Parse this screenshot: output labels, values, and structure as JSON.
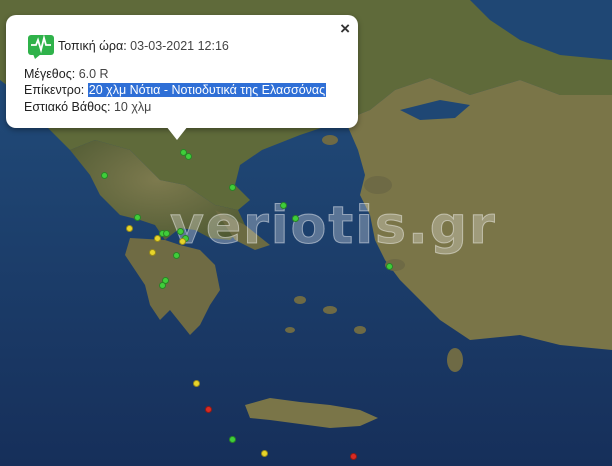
{
  "popup": {
    "time_label": "Τοπική ώρα:",
    "time_value": "03-03-2021 12:16",
    "magnitude_label": "Μέγεθος:",
    "magnitude_value": "6.0 R",
    "epicenter_label": "Επίκεντρο:",
    "epicenter_value": "20 χλμ Νότια - Νοτιοδυτικά της Ελασσόνας",
    "depth_label": "Εστιακό Βάθος:",
    "depth_value": "10 χλμ",
    "close_symbol": "×"
  },
  "watermark": "veriotis.gr",
  "marker_colors": {
    "green": "#3fce3a",
    "yellow": "#e8d52a",
    "red": "#d92a22"
  },
  "markers": [
    {
      "color": "green"
    },
    {
      "color": "green"
    },
    {
      "color": "green"
    },
    {
      "color": "green"
    },
    {
      "color": "green"
    },
    {
      "color": "green"
    },
    {
      "color": "green"
    },
    {
      "color": "green"
    },
    {
      "color": "green"
    },
    {
      "color": "green"
    },
    {
      "color": "green"
    },
    {
      "color": "green"
    },
    {
      "color": "green"
    },
    {
      "color": "green"
    },
    {
      "color": "green"
    },
    {
      "color": "green"
    },
    {
      "color": "yellow"
    },
    {
      "color": "yellow"
    },
    {
      "color": "yellow"
    },
    {
      "color": "yellow"
    },
    {
      "color": "yellow"
    },
    {
      "color": "yellow"
    },
    {
      "color": "red"
    },
    {
      "color": "red"
    }
  ]
}
